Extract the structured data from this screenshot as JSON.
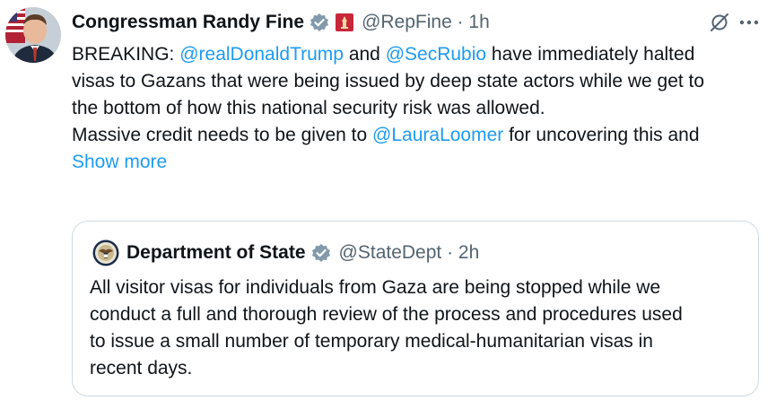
{
  "tweet": {
    "author_name": "Congressman Randy Fine",
    "handle_time": "@RepFine · 1h",
    "lines": [
      [
        {
          "t": "BREAKING: ",
          "link": false
        },
        {
          "t": "@realDonaldTrump",
          "link": true
        },
        {
          "t": " and ",
          "link": false
        },
        {
          "t": "@SecRubio",
          "link": true
        },
        {
          "t": " have immediately halted",
          "link": false
        }
      ],
      [
        {
          "t": "visas to Gazans that were being issued by deep state actors while we get to",
          "link": false
        }
      ],
      [
        {
          "t": "the bottom of how this national security risk was allowed.",
          "link": false
        }
      ],
      [
        {
          "t": " ",
          "link": false
        }
      ],
      [
        {
          "t": "Massive credit needs to be given to ",
          "link": false
        },
        {
          "t": "@LauraLoomer",
          "link": true
        },
        {
          "t": " for uncovering this and",
          "link": false
        }
      ]
    ],
    "show_more": "Show more"
  },
  "quoted": {
    "author_name": "Department of State",
    "handle_time": "@StateDept · 2h",
    "lines": [
      "All visitor visas for individuals from Gaza are being stopped while we",
      "conduct a full and thorough review of the process and procedures used",
      "to issue a small number of temporary medical-humanitarian visas in",
      "recent days."
    ]
  },
  "colors": {
    "link": "#1d9bf0",
    "verified": "#829aab",
    "muted": "#536471"
  },
  "icons": [
    "avatar",
    "verified-badge-icon",
    "congress-flag-icon",
    "grok-icon",
    "more-icon",
    "state-seal-icon"
  ]
}
